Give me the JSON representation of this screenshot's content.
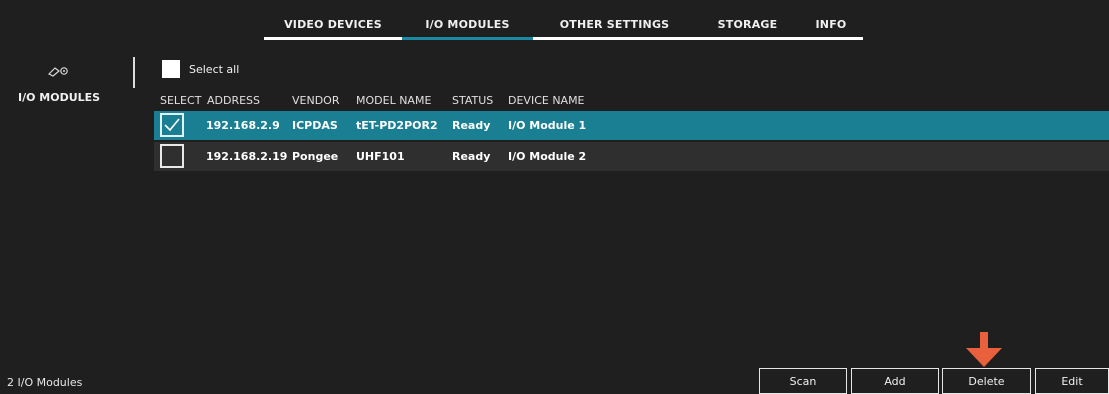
{
  "tabs": [
    {
      "label": "VIDEO DEVICES"
    },
    {
      "label": "I/O MODULES",
      "active": true
    },
    {
      "label": "OTHER SETTINGS"
    },
    {
      "label": "STORAGE"
    },
    {
      "label": "INFO"
    }
  ],
  "sidebar": {
    "label": "I/O MODULES"
  },
  "select_all": {
    "label": "Select all"
  },
  "table": {
    "headers": [
      "SELECT",
      "ADDRESS",
      "VENDOR",
      "MODEL NAME",
      "STATUS",
      "DEVICE NAME"
    ],
    "rows": [
      {
        "selected": true,
        "address": "192.168.2.9",
        "vendor": "ICPDAS",
        "model": "tET-PD2POR2",
        "status": "Ready",
        "device": "I/O Module 1"
      },
      {
        "selected": false,
        "address": "192.168.2.19",
        "vendor": "Pongee",
        "model": "UHF101",
        "status": "Ready",
        "device": "I/O Module 2"
      }
    ]
  },
  "footer": {
    "count": "2 I/O Modules"
  },
  "buttons": {
    "scan": "Scan",
    "add": "Add",
    "delete": "Delete",
    "edit": "Edit"
  },
  "colors": {
    "accent": "#1a7f93",
    "background": "#1f1f1f",
    "arrow": "#e8603c"
  },
  "icons": {
    "module": "io-module-icon",
    "arrow": "down-arrow-icon",
    "check": "checkmark-icon"
  }
}
